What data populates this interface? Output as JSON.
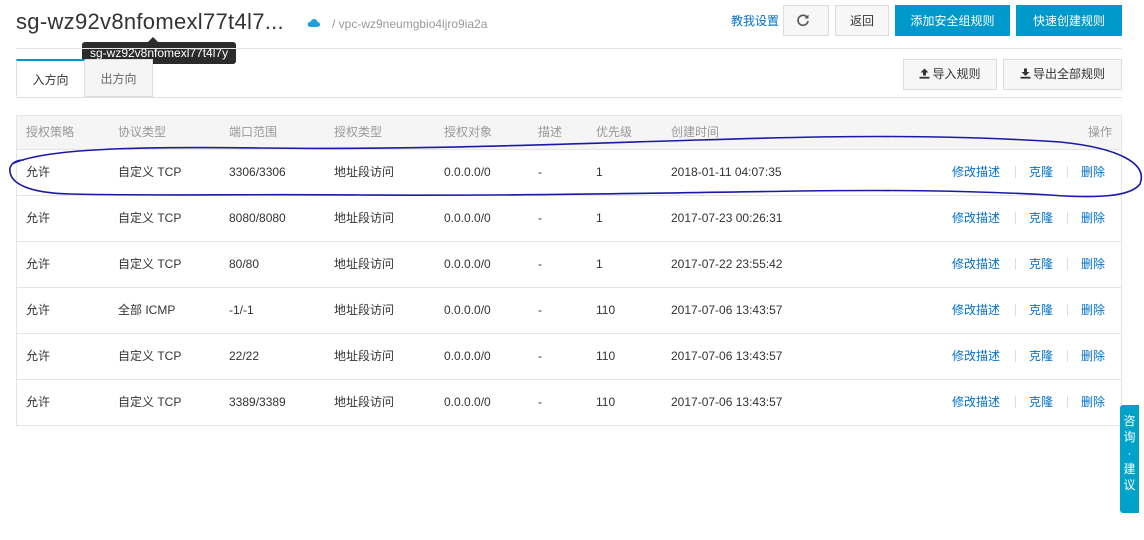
{
  "header": {
    "title": "sg-wz92v8nfomexl77t4l7...",
    "tooltip": "sg-wz92v8nfomexl77t4l7y",
    "vpc": "/ vpc-wz9neumgbio4ljro9ia2a",
    "help_link": "教我设置",
    "back_label": "返回",
    "add_rule_label": "添加安全组规则",
    "quick_create_label": "快速创建规则"
  },
  "tabs": [
    {
      "label": "入方向",
      "active": true
    },
    {
      "label": "出方向",
      "active": false
    }
  ],
  "actions": {
    "import_label": "导入规则",
    "export_label": "导出全部规则"
  },
  "table": {
    "columns": [
      "授权策略",
      "协议类型",
      "端口范围",
      "授权类型",
      "授权对象",
      "描述",
      "优先级",
      "创建时间",
      "操作"
    ],
    "op_labels": {
      "edit": "修改描述",
      "clone": "克隆",
      "delete": "删除"
    },
    "rows": [
      {
        "policy": "允许",
        "protocol": "自定义 TCP",
        "ports": "3306/3306",
        "auth_type": "地址段访问",
        "auth_object": "0.0.0.0/0",
        "desc": "-",
        "priority": "1",
        "created": "2018-01-11 04:07:35"
      },
      {
        "policy": "允许",
        "protocol": "自定义 TCP",
        "ports": "8080/8080",
        "auth_type": "地址段访问",
        "auth_object": "0.0.0.0/0",
        "desc": "-",
        "priority": "1",
        "created": "2017-07-23 00:26:31"
      },
      {
        "policy": "允许",
        "protocol": "自定义 TCP",
        "ports": "80/80",
        "auth_type": "地址段访问",
        "auth_object": "0.0.0.0/0",
        "desc": "-",
        "priority": "1",
        "created": "2017-07-22 23:55:42"
      },
      {
        "policy": "允许",
        "protocol": "全部 ICMP",
        "ports": "-1/-1",
        "auth_type": "地址段访问",
        "auth_object": "0.0.0.0/0",
        "desc": "-",
        "priority": "110",
        "created": "2017-07-06 13:43:57"
      },
      {
        "policy": "允许",
        "protocol": "自定义 TCP",
        "ports": "22/22",
        "auth_type": "地址段访问",
        "auth_object": "0.0.0.0/0",
        "desc": "-",
        "priority": "110",
        "created": "2017-07-06 13:43:57"
      },
      {
        "policy": "允许",
        "protocol": "自定义 TCP",
        "ports": "3389/3389",
        "auth_type": "地址段访问",
        "auth_object": "0.0.0.0/0",
        "desc": "-",
        "priority": "110",
        "created": "2017-07-06 13:43:57"
      }
    ]
  },
  "side_widget": {
    "label": "咨询·建议"
  },
  "colors": {
    "primary": "#0099cc",
    "link": "#0070cc",
    "annotation": "#1a1aa6"
  }
}
